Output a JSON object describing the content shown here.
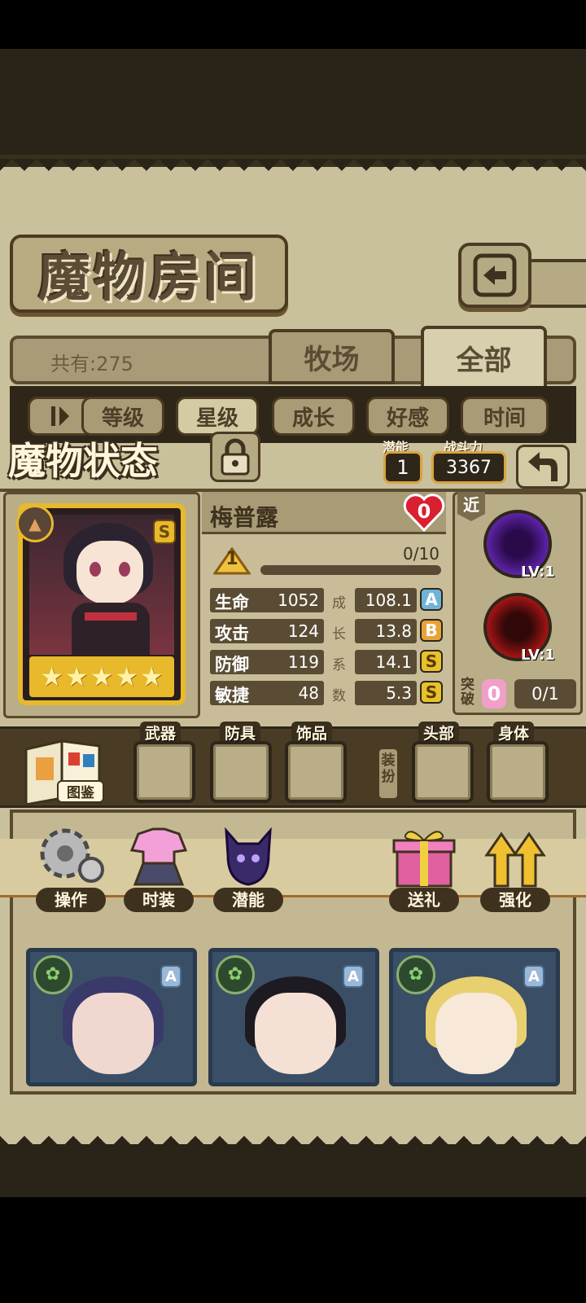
{
  "screen": {
    "room_title": "魔物房间",
    "count_label": "共有:275",
    "tabs": [
      {
        "label": "牧场"
      },
      {
        "label": "全部"
      }
    ],
    "sort_buttons": [
      {
        "label": "等级"
      },
      {
        "label": "星级"
      },
      {
        "label": "成长"
      },
      {
        "label": "好感"
      },
      {
        "label": "时间"
      }
    ]
  },
  "status": {
    "title": "魔物状态",
    "potential_label": "潜能",
    "potential_value": "1",
    "power_label": "战斗力",
    "power_value": "3367",
    "name": "梅普露",
    "affection": "0",
    "level": "1",
    "exp": "0/10",
    "rank": "S",
    "stars": 5,
    "stats": [
      {
        "label": "生命",
        "value": "1052",
        "growth": "108.1",
        "grade": "A"
      },
      {
        "label": "攻击",
        "value": "124",
        "growth": "13.8",
        "grade": "B"
      },
      {
        "label": "防御",
        "value": "119",
        "growth": "14.1",
        "grade": "S"
      },
      {
        "label": "敏捷",
        "value": "48",
        "growth": "5.3",
        "grade": "S"
      }
    ],
    "growth_vertical_label": [
      "成",
      "长",
      "系",
      "数"
    ],
    "range_tag": "近",
    "skills": [
      {
        "level": "LV:1",
        "color": "#5a2a9a"
      },
      {
        "level": "LV:1",
        "color": "#b01818"
      }
    ],
    "break_label": "突破",
    "break_count": "0",
    "break_progress": "0/1"
  },
  "equipment": {
    "book_label": "图鉴",
    "slots": [
      {
        "label": "武器"
      },
      {
        "label": "防具"
      },
      {
        "label": "饰品"
      },
      {
        "label": "头部"
      },
      {
        "label": "身体"
      }
    ],
    "dress_label": "装扮"
  },
  "actions": [
    {
      "label": "操作",
      "icon": "gear-icon"
    },
    {
      "label": "时装",
      "icon": "outfit-icon"
    },
    {
      "label": "潜能",
      "icon": "potential-icon"
    },
    {
      "label": "送礼",
      "icon": "gift-icon"
    },
    {
      "label": "强化",
      "icon": "upgrade-arrows-icon"
    }
  ],
  "cards": [
    {
      "rank": "A",
      "element": "leaf-icon"
    },
    {
      "rank": "A",
      "element": "leaf-icon"
    },
    {
      "rank": "A",
      "element": "leaf-icon"
    }
  ]
}
